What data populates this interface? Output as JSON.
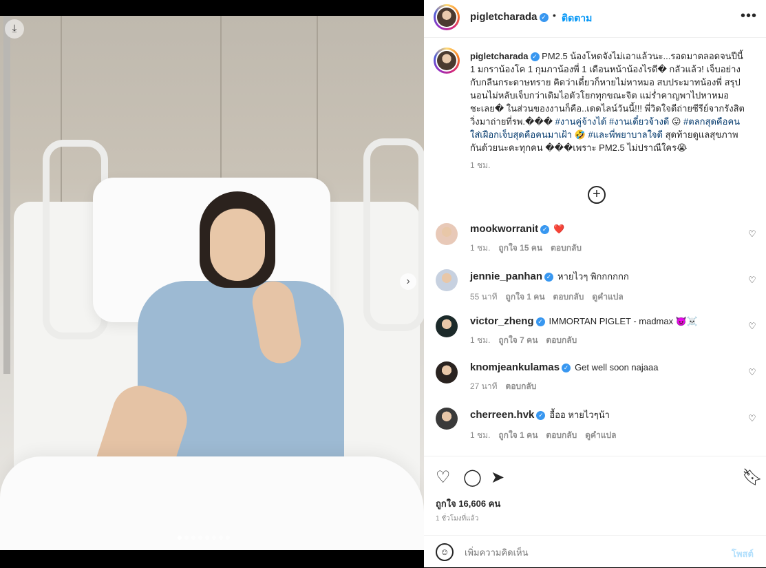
{
  "post": {
    "author": "pigletcharada",
    "follow_label": "ติดตาม",
    "bullet": "•",
    "more_icon": "more-horizontal-icon",
    "caption_parts": [
      {
        "type": "text",
        "value": "PM2.5 น้องโหดจังไม่เอาแล้วนะ...รอดมาตลอดจนปีนี้ 1 มกราน้องโค 1 กุมภาน้องพี่ 1 เดือนหน้าน้องไรดี� กลัวแล้ว! เจ็บอย่างกับกลืนกระดาษทราย คิดว่าเดี๋ยวก็หายไม่หาหมอ สบประมาทน้องพี่ สรุปนอนไม่หลับเจ็บกว่าเดิมไอตัวโยกทุกขณะจิต แม่ร่ำคาญพาไปหาหมอชะเลย� ในส่วนของงานก็คือ..เดดไลน์วันนี้!!! พี่วิดใจดีถ่ายซีรีย์จากรังสิตวิ่งมาถ่ายที่รพ.��� "
      },
      {
        "type": "tag",
        "value": "#งานคู่จ้างได้"
      },
      {
        "type": "text",
        "value": " "
      },
      {
        "type": "tag",
        "value": "#งานเดี๋ยวจ้างดี"
      },
      {
        "type": "text",
        "value": " 😛 "
      },
      {
        "type": "tag",
        "value": "#ตลกสุดคือคนใส่เฝือกเจ็บสุดคือคนมาเฝ้า"
      },
      {
        "type": "text",
        "value": " 🤣 "
      },
      {
        "type": "tag",
        "value": "#และพี่พยาบาลใจดี"
      },
      {
        "type": "text",
        "value": " สุดท้ายดูแลสุขภาพกันด้วยนะคะทุกคน ���เพราะ PM2.5 ไม่ปราณีใคร😭"
      }
    ],
    "caption_time": "1 ชม.",
    "load_more_icon": "plus-circle-icon",
    "likes": "ถูกใจ 16,606 คน",
    "posted": "1 ชั่วโมงที่แล้ว",
    "comment_placeholder": "เพิ่มความคิดเห็น",
    "post_label": "โพสต์",
    "emoji_icon": "emoji-icon",
    "image_counter": {
      "active": 1,
      "total": 8
    }
  },
  "comments": [
    {
      "user": "mookworranit",
      "text": "❤️",
      "meta": [
        "1 ชม.",
        "ถูกใจ 15 คน",
        "ตอบกลับ"
      ]
    },
    {
      "user": "jennie_panhan",
      "text": "หายไวๆ พิกกกกกก",
      "meta": [
        "55 นาที",
        "ถูกใจ 1 คน",
        "ตอบกลับ",
        "ดูคำแปล"
      ]
    },
    {
      "user": "victor_zheng",
      "text": "IMMORTAN PIGLET - madmax 👿☠️",
      "meta": [
        "1 ชม.",
        "ถูกใจ 7 คน",
        "ตอบกลับ"
      ]
    },
    {
      "user": "knomjeankulamas",
      "text": "Get well soon najaaa",
      "meta": [
        "27 นาที",
        "ตอบกลับ"
      ]
    },
    {
      "user": "cherreen.hvk",
      "text": "อื้ออ หายไวๆน้า",
      "meta": [
        "1 ชม.",
        "ถูกใจ 1 คน",
        "ตอบกลับ",
        "ดูคำแปล"
      ]
    }
  ],
  "icons": {
    "like": "heart-icon",
    "comment": "comment-icon",
    "share": "send-icon",
    "save": "bookmark-icon",
    "verified": "verified-badge-icon",
    "next": "chevron-right-icon"
  }
}
